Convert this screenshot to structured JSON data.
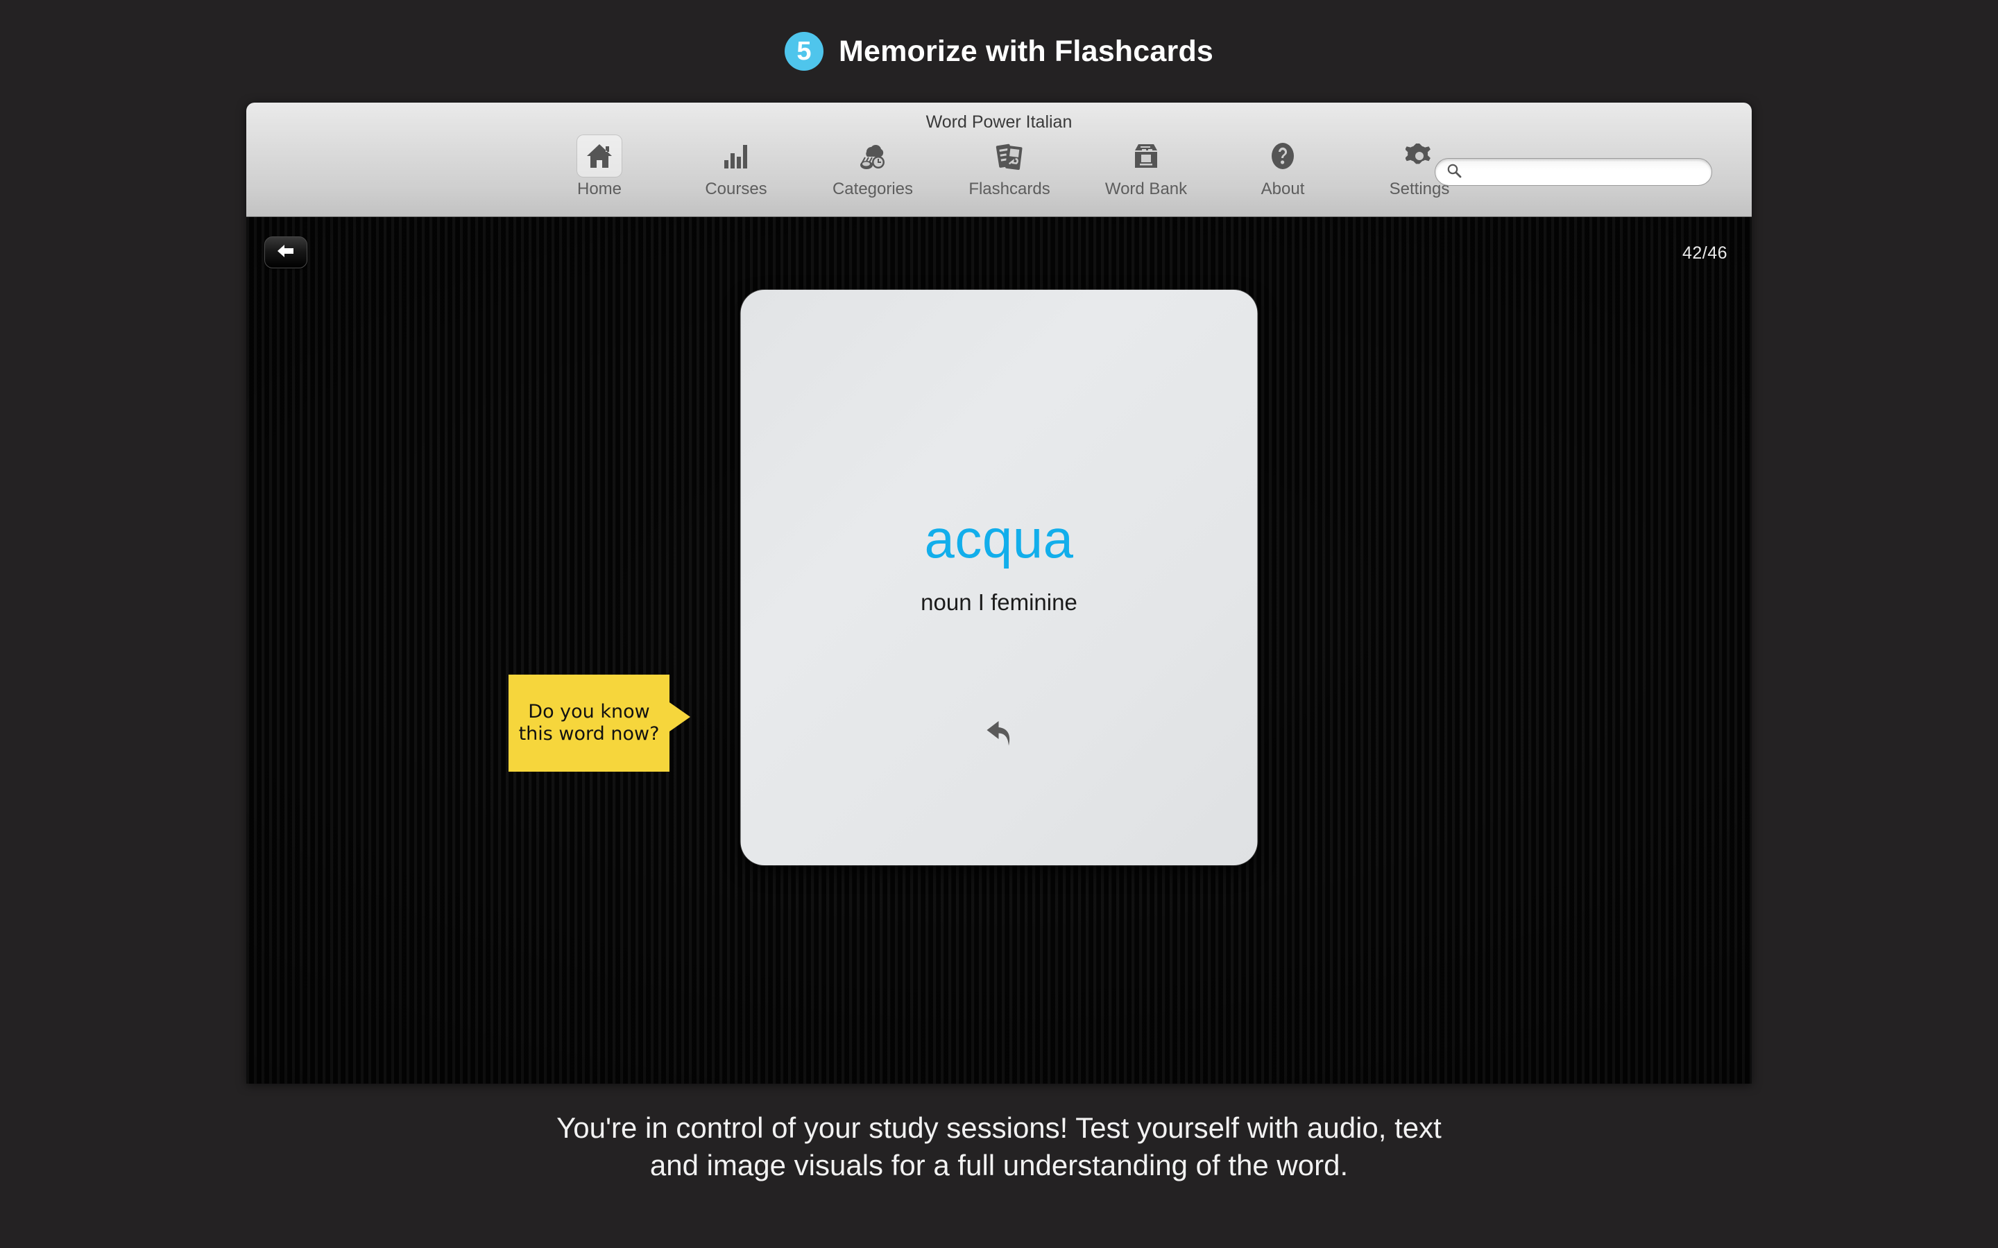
{
  "promo": {
    "step_number": "5",
    "title": "Memorize with Flashcards",
    "caption_line1": "You're in control of your study sessions! Test yourself with audio, text",
    "caption_line2": "and image visuals for a full understanding of the word.",
    "accent_color": "#4FC5EC"
  },
  "window": {
    "title": "Word Power Italian"
  },
  "toolbar": {
    "items": [
      {
        "label": "Home",
        "icon": "house-icon",
        "selected": true
      },
      {
        "label": "Courses",
        "icon": "bar-chart-icon",
        "selected": false
      },
      {
        "label": "Categories",
        "icon": "cloud-clock-icon",
        "selected": false
      },
      {
        "label": "Flashcards",
        "icon": "flashcards-icon",
        "selected": false
      },
      {
        "label": "Word Bank",
        "icon": "file-box-icon",
        "selected": false
      },
      {
        "label": "About",
        "icon": "question-mark-icon",
        "selected": false
      },
      {
        "label": "Settings",
        "icon": "gear-icon",
        "selected": false
      }
    ],
    "search": {
      "value": "",
      "placeholder": ""
    }
  },
  "stage": {
    "back_button_icon": "left-arrow-icon",
    "card_counter": "42/46",
    "flashcard": {
      "word": "acqua",
      "word_color": "#12AEEB",
      "part_of_speech": "noun I feminine",
      "flip_icon": "flip-back-arrow-icon"
    },
    "callout": {
      "text": "Do you know this word now?",
      "background_color": "#F6D63C"
    }
  }
}
